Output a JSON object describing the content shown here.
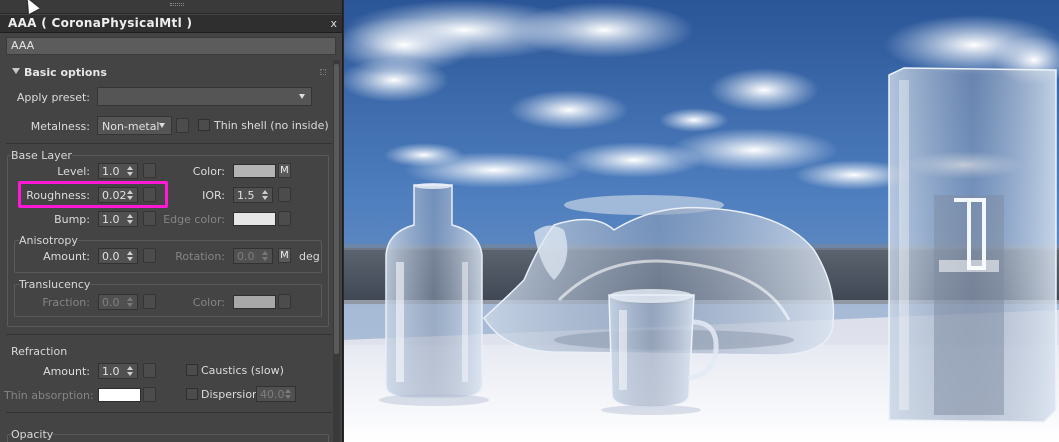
{
  "material": {
    "title": "AAA  ( CoronaPhysicalMtl )",
    "name": "AAA",
    "close_glyph": "x"
  },
  "basic": {
    "header": "Basic options",
    "apply_preset_label": "Apply preset:",
    "apply_preset_value": "",
    "metalness_label": "Metalness:",
    "metalness_value": "Non-metal",
    "thin_shell_label": "Thin shell (no inside)"
  },
  "base_layer": {
    "label": "Base Layer",
    "level_label": "Level:",
    "level_value": "1.0",
    "color_label": "Color:",
    "color_swatch": "#b4b4b4",
    "m_label": "M",
    "roughness_label": "Roughness:",
    "roughness_value": "0.02",
    "ior_label": "IOR:",
    "ior_value": "1.5",
    "bump_label": "Bump:",
    "bump_value": "1.0",
    "edge_color_label": "Edge color:",
    "edge_color_swatch": "#e6e6e6"
  },
  "anisotropy": {
    "label": "Anisotropy",
    "amount_label": "Amount:",
    "amount_value": "0.0",
    "rotation_label": "Rotation:",
    "rotation_value": "0.0",
    "m_label": "M",
    "unit": "deg"
  },
  "translucency": {
    "label": "Translucency",
    "fraction_label": "Fraction:",
    "fraction_value": "0.0",
    "color_label": "Color:",
    "color_swatch": "#a8a8a8"
  },
  "refraction": {
    "label": "Refraction",
    "amount_label": "Amount:",
    "amount_value": "1.0",
    "caustics_label": "Caustics (slow)",
    "thin_absorption_label": "Thin absorption:",
    "thin_absorption_swatch": "#ffffff",
    "dispersion_label": "Dispersion",
    "dispersion_value": "40.0"
  },
  "opacity": {
    "label": "Opacity"
  },
  "colors": {
    "highlight": "#ff19d6",
    "panel_bg": "#444444",
    "sky_top": "#2d5c9e",
    "ground": "#e8eaf4"
  }
}
